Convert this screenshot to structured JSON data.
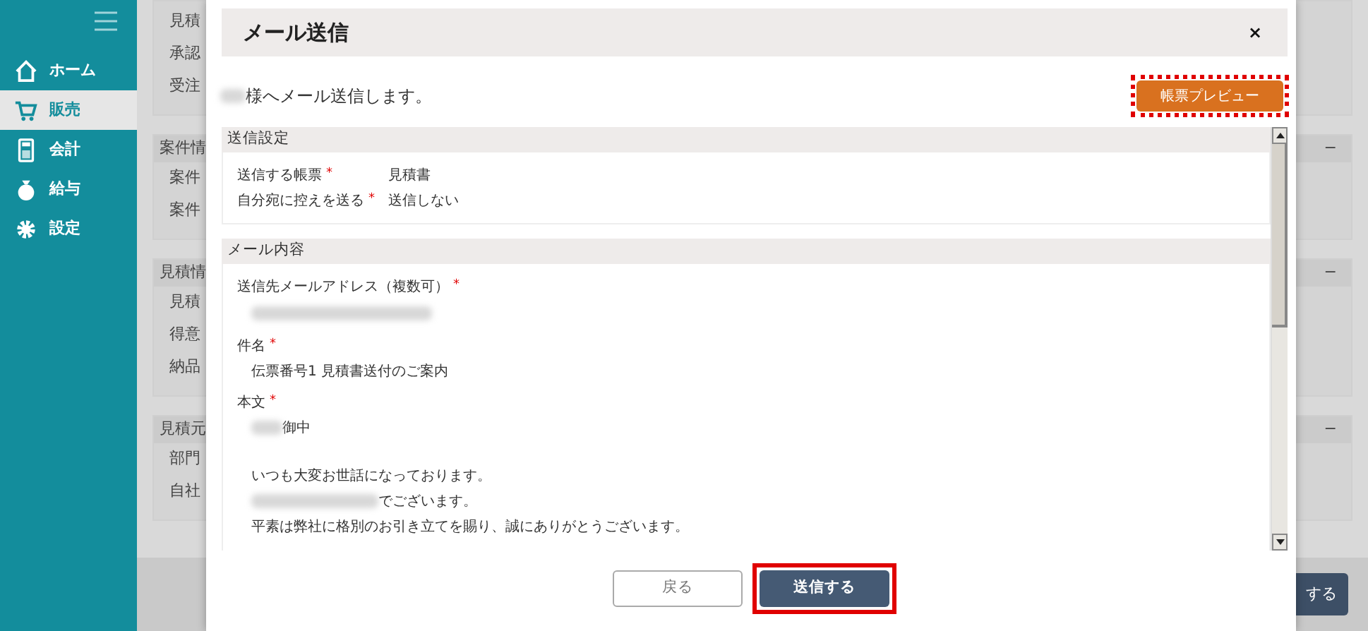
{
  "sidebar": {
    "items": [
      {
        "label": "ホーム",
        "selected": false
      },
      {
        "label": "販売",
        "selected": true
      },
      {
        "label": "会計",
        "selected": false
      },
      {
        "label": "給与",
        "selected": false
      },
      {
        "label": "設定",
        "selected": false
      }
    ]
  },
  "background": {
    "panels": [
      {
        "rows": [
          "見積",
          "承認",
          "受注"
        ]
      },
      {
        "title": "案件情",
        "collapse": "−",
        "rows": [
          "案件",
          "案件"
        ]
      },
      {
        "title": "見積情",
        "collapse": "−",
        "rows": [
          "見積",
          "得意",
          "納品"
        ]
      },
      {
        "title": "見積元",
        "collapse": "−",
        "rows": [
          "部門",
          "自社"
        ]
      }
    ],
    "action_button": "する"
  },
  "dialog": {
    "title": "メール送信",
    "close": "×",
    "intro": {
      "text": "様へメール送信します。",
      "blurred_prefix": true
    },
    "preview_button": {
      "label": "帳票プレビュー",
      "highlighted": true
    },
    "sections": [
      {
        "title": "送信設定",
        "kind": "settings",
        "fields": [
          {
            "label": "送信する帳票",
            "required_mark": "*",
            "value": "見積書"
          },
          {
            "label": "自分宛に控えを送る",
            "required_mark": "*",
            "value": "送信しない"
          }
        ]
      },
      {
        "title": "メール内容",
        "kind": "content",
        "fields": [
          {
            "label": "送信先メールアドレス（複数可）",
            "required_mark": "*",
            "blurred_value": true
          },
          {
            "label": "件名",
            "required_mark": "*",
            "lines": [
              {
                "text": "伝票番号1 見積書送付のご案内",
                "blurred_prefix": false,
                "space_before": false
              }
            ]
          },
          {
            "label": "本文",
            "required_mark": "*",
            "lines": [
              {
                "text": "御中",
                "blurred_prefix": true,
                "space_before": false
              },
              {
                "text": "いつも大変お世話になっております。",
                "blurred_prefix": false,
                "space_before": true
              },
              {
                "text": "でございます。",
                "blurred_prefix": true,
                "space_before": false
              },
              {
                "text": "平素は弊社に格別のお引き立てを賜り、誠にありがとうございます。",
                "blurred_prefix": false,
                "space_before": false
              }
            ]
          }
        ]
      }
    ],
    "buttons": [
      {
        "label": "戻る",
        "kind": "secondary",
        "highlighted": false
      },
      {
        "label": "送信する",
        "kind": "primary",
        "highlighted": true
      }
    ]
  }
}
